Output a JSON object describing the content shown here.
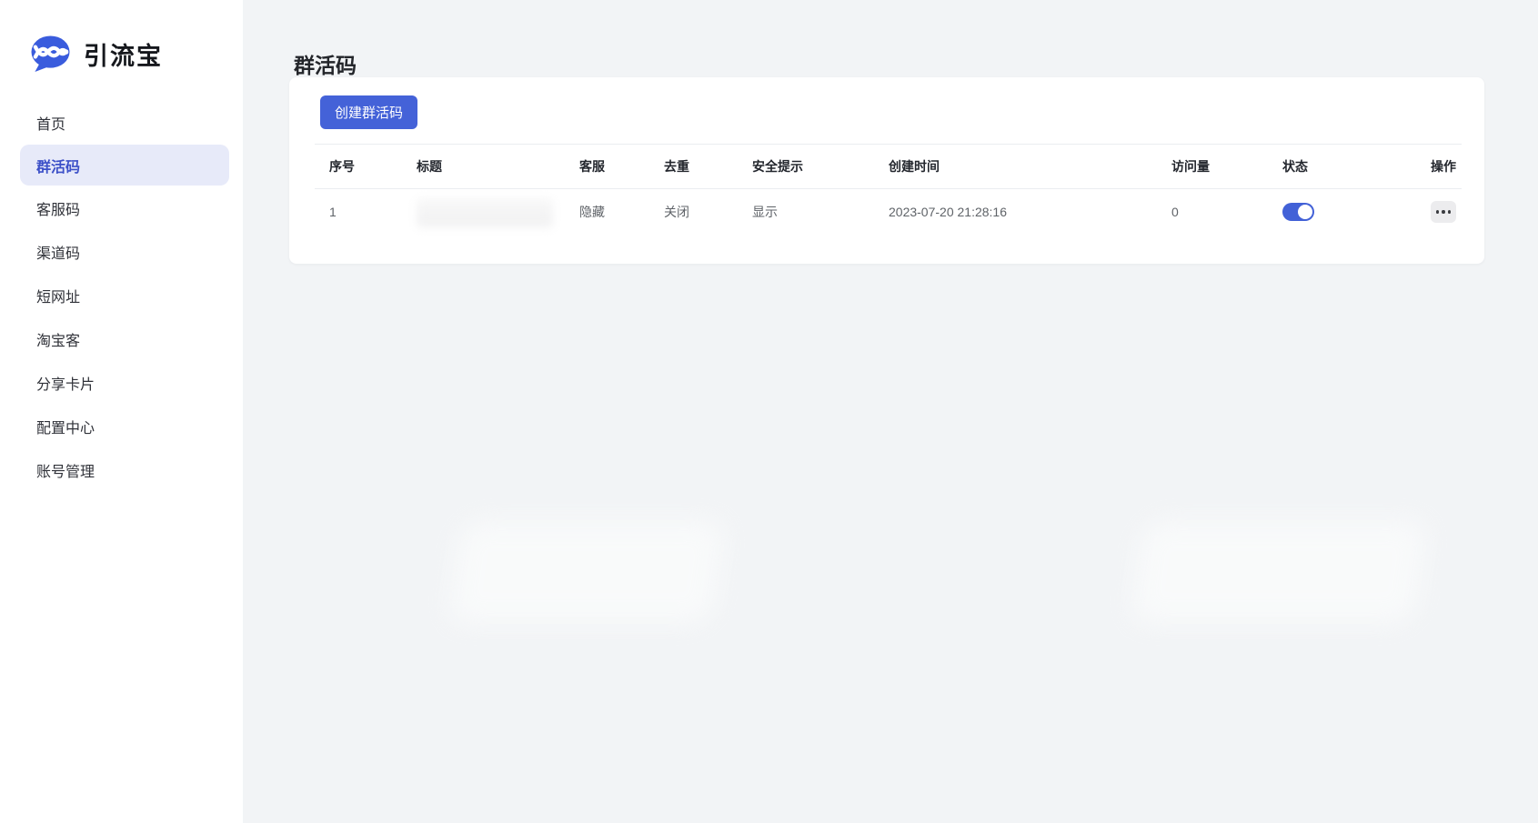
{
  "brand": {
    "name": "引流宝"
  },
  "sidebar": {
    "items": [
      {
        "label": "首页",
        "active": false
      },
      {
        "label": "群活码",
        "active": true
      },
      {
        "label": "客服码",
        "active": false
      },
      {
        "label": "渠道码",
        "active": false
      },
      {
        "label": "短网址",
        "active": false
      },
      {
        "label": "淘宝客",
        "active": false
      },
      {
        "label": "分享卡片",
        "active": false
      },
      {
        "label": "配置中心",
        "active": false
      },
      {
        "label": "账号管理",
        "active": false
      }
    ]
  },
  "page": {
    "title": "群活码"
  },
  "toolbar": {
    "create_button_label": "创建群活码"
  },
  "table": {
    "columns": [
      "序号",
      "标题",
      "客服",
      "去重",
      "安全提示",
      "创建时间",
      "访问量",
      "状态",
      "操作"
    ],
    "rows": [
      {
        "index": "1",
        "title": "",
        "service": "隐藏",
        "dedupe": "关闭",
        "safety_tip": "显示",
        "created_at": "2023-07-20 21:28:16",
        "visits": "0",
        "status_on": true
      }
    ]
  },
  "icons": {
    "logo": "chat-bubble-wave-logo",
    "row_actions": "ellipsis-icon"
  },
  "colors": {
    "accent_blue": "#4462d8",
    "toggle_on": "#4261d7",
    "sidebar_active_bg": "#e7eaf9",
    "sidebar_active_text": "#3c50c8",
    "page_background": "#f2f4f6",
    "card_background": "#ffffff",
    "table_border": "#ebedf0"
  }
}
